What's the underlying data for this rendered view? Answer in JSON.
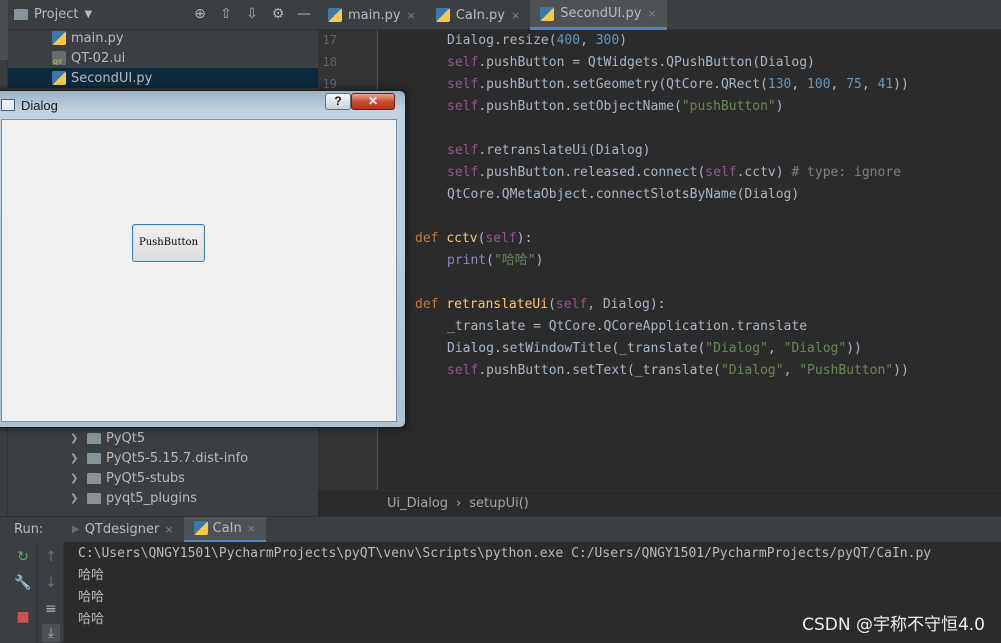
{
  "project_panel": {
    "title": "Project",
    "tools": {
      "locate": "⊕",
      "expand": "⇧",
      "collapse": "⇩",
      "settings": "⚙",
      "hide": "—"
    },
    "files": [
      {
        "name": "main.py",
        "icon": "python-file-icon"
      },
      {
        "name": "QT-02.ui",
        "icon": "ui-file-icon"
      },
      {
        "name": "SecondUI.py",
        "icon": "python-file-icon",
        "selected": true
      }
    ],
    "folders": [
      {
        "name": "PyQt5"
      },
      {
        "name": "PyQt5-5.15.7.dist-info"
      },
      {
        "name": "PyQt5-stubs"
      },
      {
        "name": "pyqt5_plugins"
      }
    ]
  },
  "editor": {
    "tabs": [
      {
        "label": "main.py",
        "close": "×"
      },
      {
        "label": "CaIn.py",
        "close": "×"
      },
      {
        "label": "SecondUI.py",
        "close": "×",
        "active": true
      }
    ],
    "line_numbers": [
      "17",
      "18",
      "19"
    ],
    "breadcrumb": {
      "class_name": "Ui_Dialog",
      "separator": "›",
      "method": "setupUi()"
    }
  },
  "dialog": {
    "title": "Dialog",
    "help_label": "?",
    "close_label": "✕",
    "button_label": "PushButton"
  },
  "run_panel": {
    "label": "Run:",
    "tabs": [
      {
        "label": "QTdesigner",
        "close": "×"
      },
      {
        "label": "CaIn",
        "close": "×",
        "active": true
      }
    ],
    "console": [
      "C:\\Users\\QNGY1501\\PycharmProjects\\pyQT\\venv\\Scripts\\python.exe C:/Users/QNGY1501/PycharmProjects/pyQT/CaIn.py",
      "哈哈",
      "哈哈",
      "哈哈"
    ]
  },
  "watermark": "CSDN @宇称不守恒4.0"
}
